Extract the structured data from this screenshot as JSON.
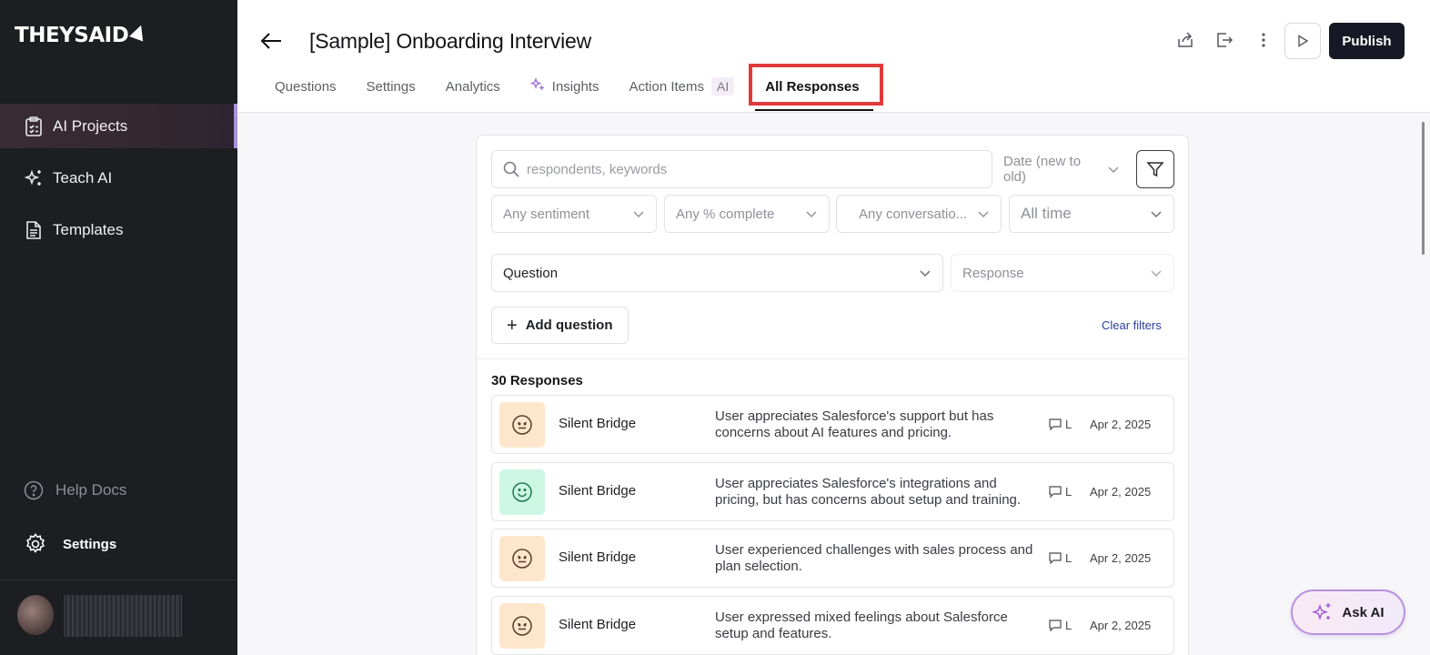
{
  "brand": {
    "logo_text": "THEYSAID"
  },
  "sidebar": {
    "items": [
      {
        "label": "AI Projects",
        "icon": "clipboard-icon",
        "active": true
      },
      {
        "label": "Teach AI",
        "icon": "sparkle-icon",
        "active": false
      },
      {
        "label": "Templates",
        "icon": "document-icon",
        "active": false
      }
    ],
    "help_label": "Help Docs",
    "settings_label": "Settings"
  },
  "header": {
    "title": "[Sample] Onboarding Interview",
    "publish_label": "Publish",
    "tabs": [
      {
        "label": "Questions"
      },
      {
        "label": "Settings"
      },
      {
        "label": "Analytics"
      },
      {
        "label": "Insights"
      },
      {
        "label": "Action Items",
        "badge": "AI"
      },
      {
        "label": "All Responses",
        "active": true
      }
    ]
  },
  "filters": {
    "search_placeholder": "respondents, keywords",
    "sort": "Date (new to old)",
    "sentiment": "Any sentiment",
    "complete": "Any % complete",
    "conversation": "Any conversatio...",
    "time": "All time",
    "question": "Question",
    "response": "Response",
    "add_question": "Add question",
    "clear_filters": "Clear filters"
  },
  "responses": {
    "count_label": "30 Responses",
    "items": [
      {
        "name": "Silent Bridge",
        "sentiment": "neutral",
        "summary": "User appreciates Salesforce's support but has concerns about AI features and pricing.",
        "channel": "L",
        "date": "Apr 2, 2025"
      },
      {
        "name": "Silent Bridge",
        "sentiment": "happy",
        "summary": "User appreciates Salesforce's integrations and pricing, but has concerns about setup and training.",
        "channel": "L",
        "date": "Apr 2, 2025"
      },
      {
        "name": "Silent Bridge",
        "sentiment": "neutral",
        "summary": "User experienced challenges with sales process and plan selection.",
        "channel": "L",
        "date": "Apr 2, 2025"
      },
      {
        "name": "Silent Bridge",
        "sentiment": "neutral",
        "summary": "User expressed mixed feelings about Salesforce setup and features.",
        "channel": "L",
        "date": "Apr 2, 2025"
      }
    ]
  },
  "ask_ai_label": "Ask AI",
  "colors": {
    "sidebar_bg": "#1d1e22",
    "publish_bg": "#161925",
    "highlight": "#e03a3a",
    "neutral_face_bg": "#fde6cc",
    "happy_face_bg": "#cdf7e4",
    "link": "#2b3ca3"
  }
}
